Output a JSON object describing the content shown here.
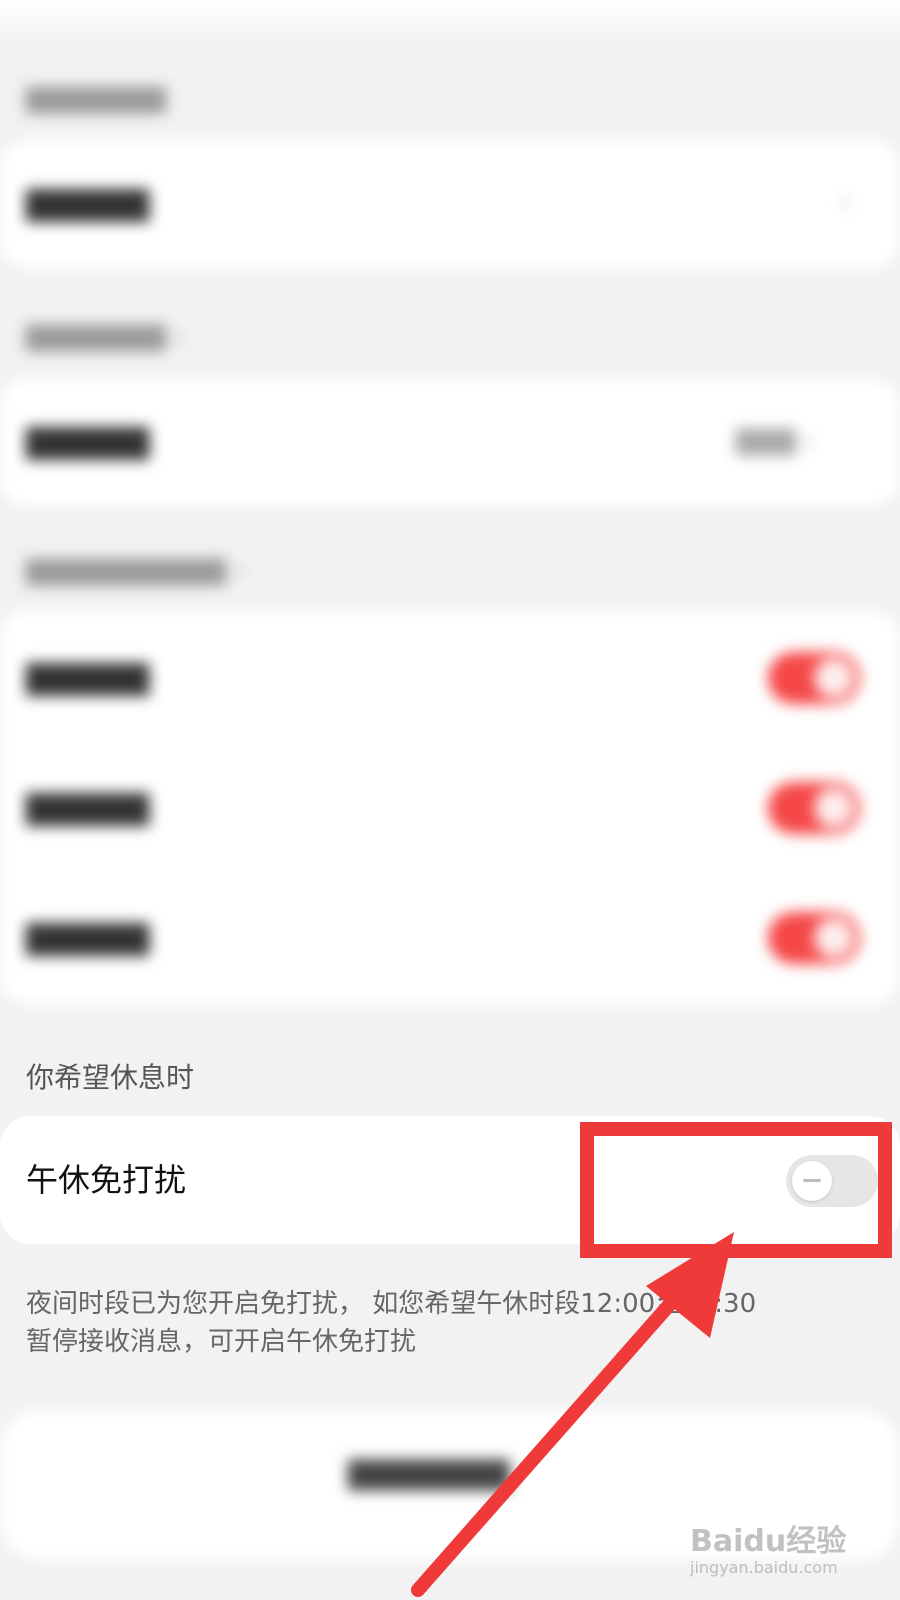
{
  "rest_section": {
    "title": "你希望休息时",
    "nap_dnd": {
      "label": "午休免打扰",
      "enabled": false
    },
    "description_line1": "夜间时段已为您开启免打扰， 如您希望午休时段12:00至13:30",
    "description_line2": "暂停接收消息，可开启午休免打扰"
  },
  "watermark": {
    "brand": "Baidu经验",
    "url": "jingyan.baidu.com"
  },
  "colors": {
    "toggle_on": "#f54747",
    "toggle_off": "#e6e6e6",
    "annotation": "#f03a3a"
  }
}
